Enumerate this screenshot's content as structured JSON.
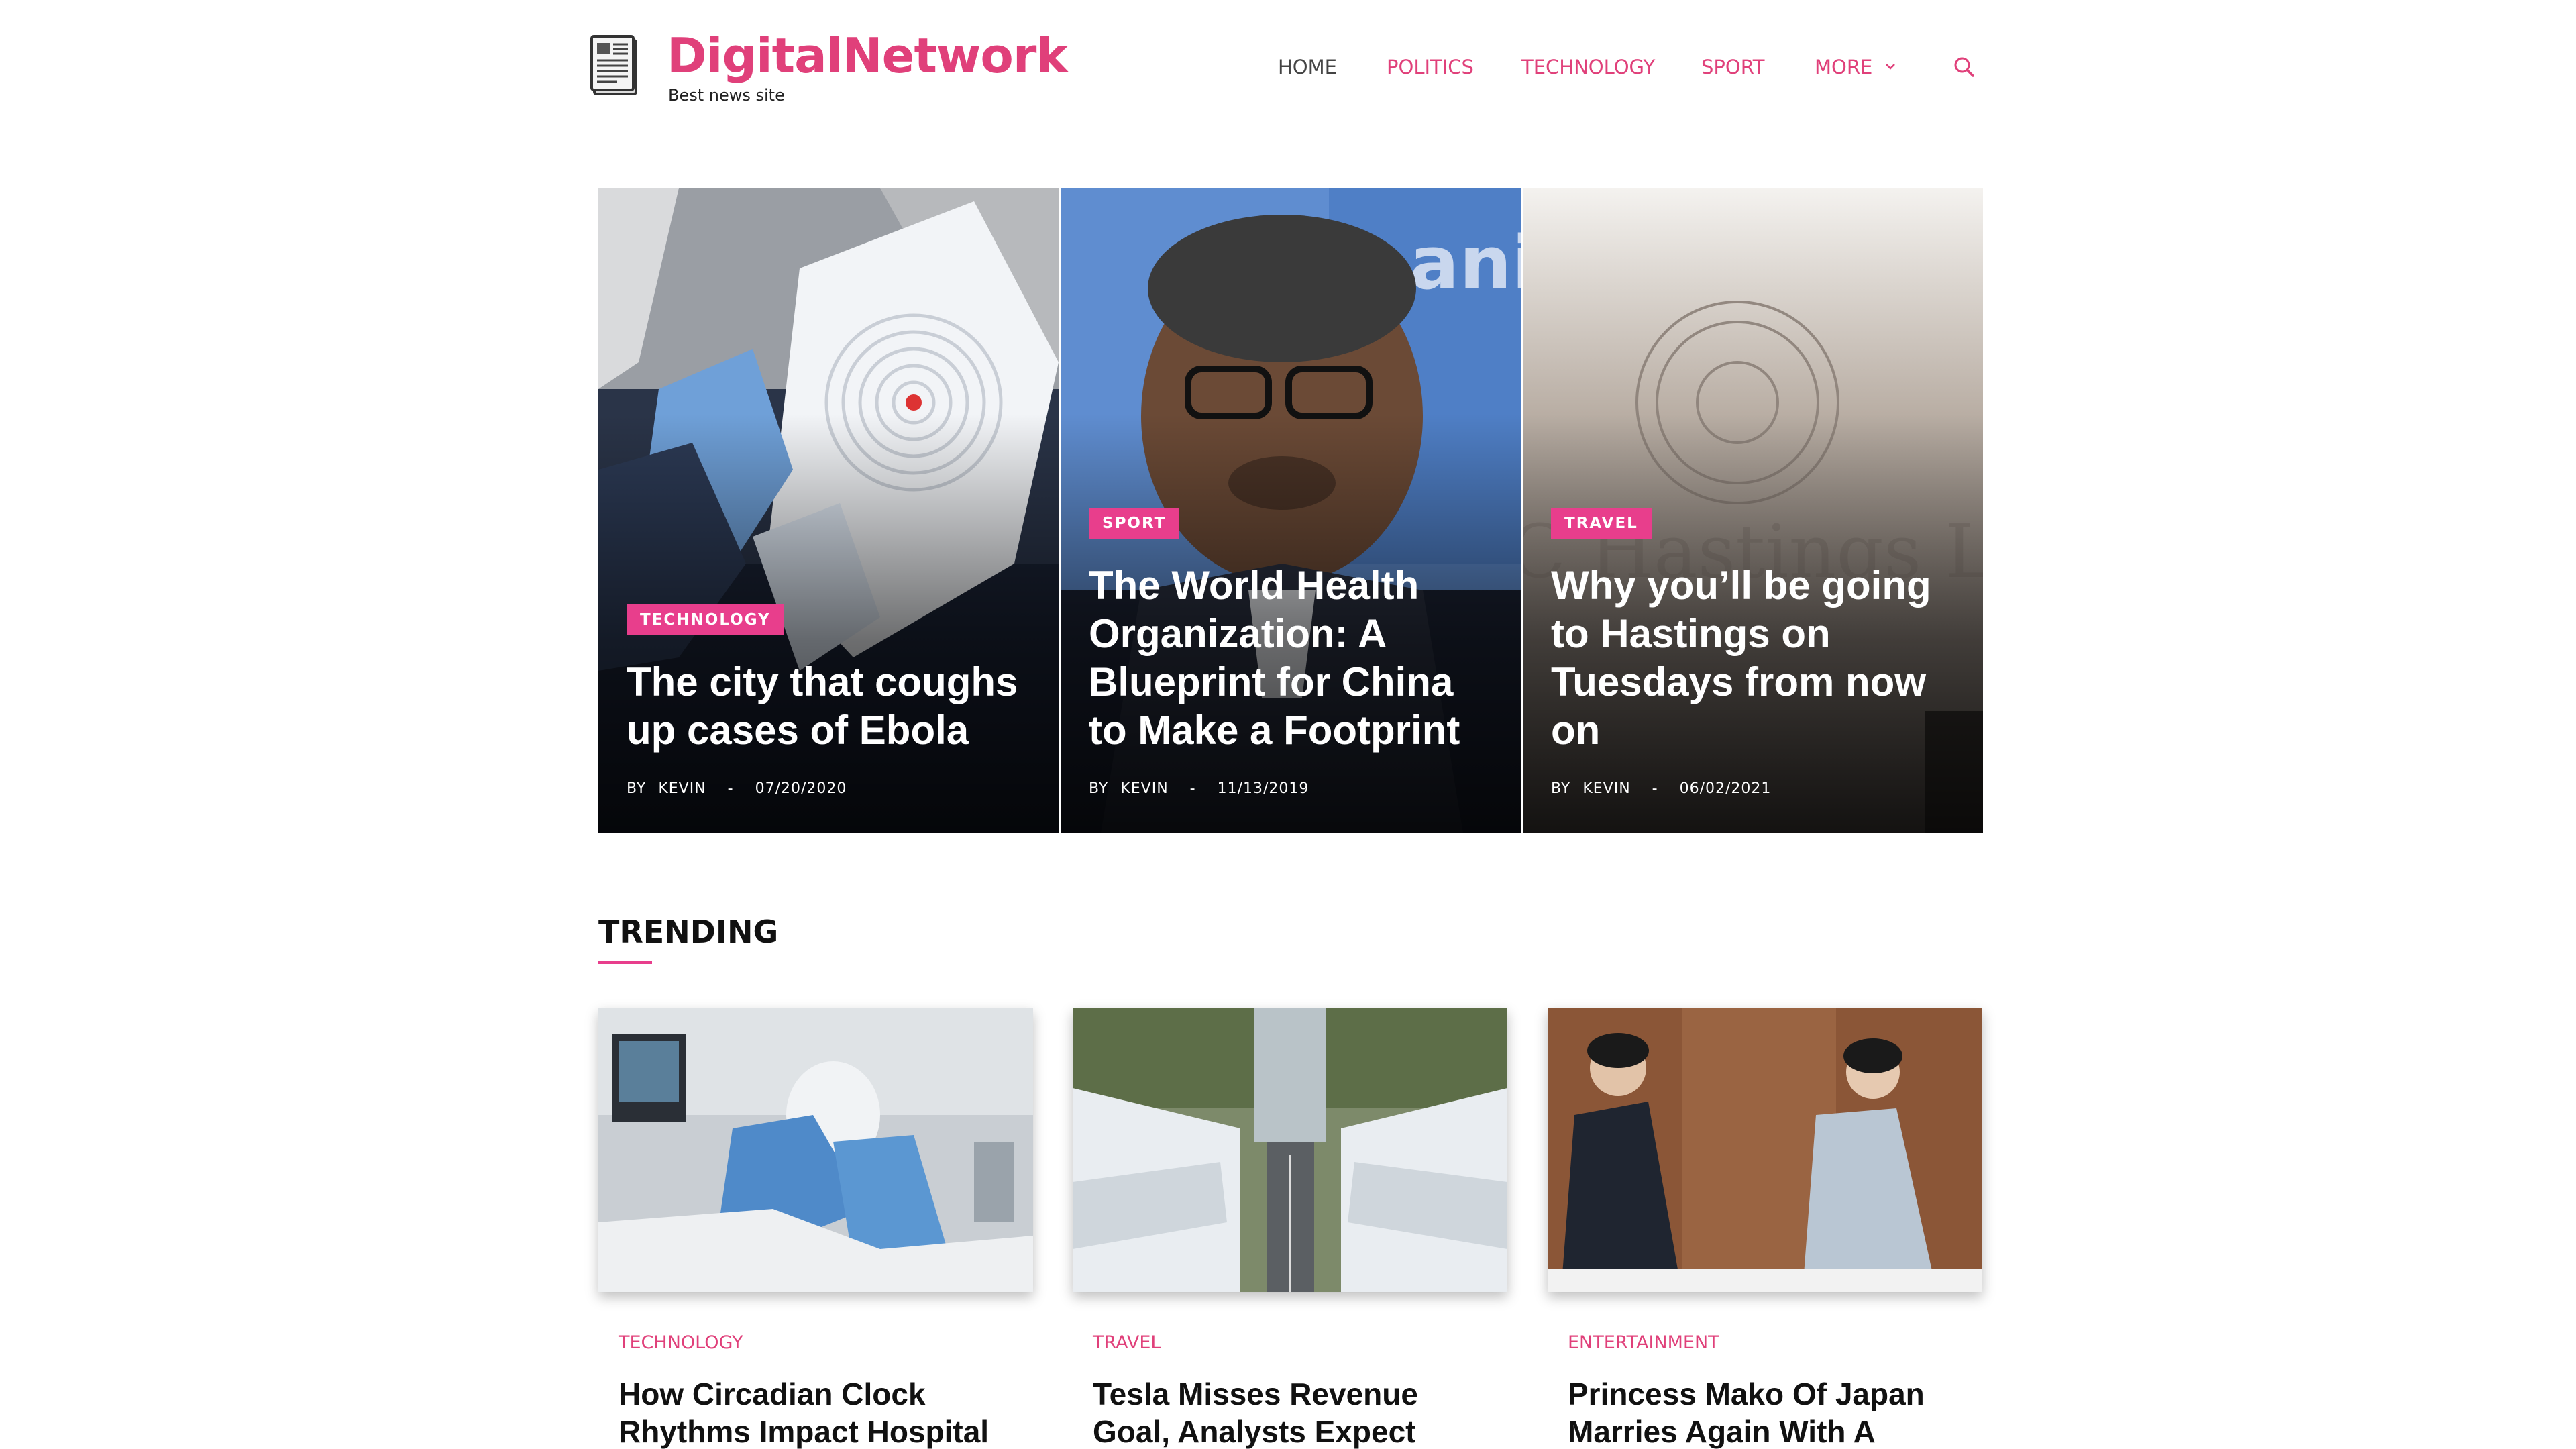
{
  "site": {
    "title": "DigitalNetwork",
    "tagline": "Best news site",
    "logo_icon": "newspaper-icon",
    "accent": "#e0407a"
  },
  "nav": {
    "items": [
      {
        "label": "HOME",
        "active": true
      },
      {
        "label": "POLITICS"
      },
      {
        "label": "TECHNOLOGY"
      },
      {
        "label": "SPORT"
      },
      {
        "label": "MORE"
      }
    ],
    "more_icon": "chevron-down-icon",
    "search_icon": "search-icon"
  },
  "hero": [
    {
      "category": "TECHNOLOGY",
      "title": "The city that coughs up cases of Ebola",
      "by": "BY",
      "author": "KEVIN",
      "sep": "-",
      "date": "07/20/2020"
    },
    {
      "category": "SPORT",
      "title": "The World Health Organization: A Blueprint for China to Make a Footprint",
      "by": "BY",
      "author": "KEVIN",
      "sep": "-",
      "date": "11/13/2019"
    },
    {
      "category": "TRAVEL",
      "title": "Why you’ll be going to Hastings on Tuesdays from now on",
      "by": "BY",
      "author": "KEVIN",
      "sep": "-",
      "date": "06/02/2021"
    }
  ],
  "trending": {
    "heading": "TRENDING",
    "items": [
      {
        "category": "TECHNOLOGY",
        "title": "How Circadian Clock Rhythms Impact Hospital"
      },
      {
        "category": "TRAVEL",
        "title": "Tesla Misses Revenue Goal, Analysts Expect More"
      },
      {
        "category": "ENTERTAINMENT",
        "title": "Princess Mako Of Japan Marries Again With A Young"
      }
    ]
  }
}
